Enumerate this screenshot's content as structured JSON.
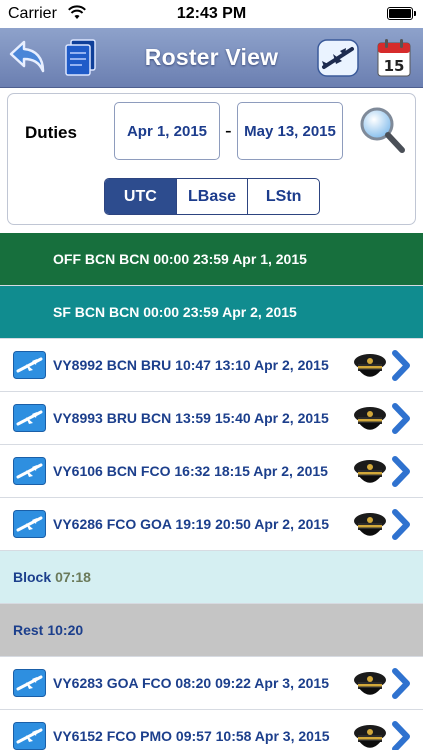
{
  "status_bar": {
    "carrier": "Carrier",
    "time": "12:43 PM"
  },
  "nav": {
    "title": "Roster View"
  },
  "filter": {
    "label": "Duties",
    "date_from": "Apr 1, 2015",
    "separator": "-",
    "date_to": "May 13, 2015",
    "time_modes": [
      "UTC",
      "LBase",
      "LStn"
    ],
    "selected_mode": "UTC"
  },
  "rows": [
    {
      "kind": "duty",
      "variant": "off",
      "text": "OFF BCN BCN 00:00 23:59 Apr 1, 2015"
    },
    {
      "kind": "duty",
      "variant": "sf",
      "text": "SF BCN BCN 00:00 23:59 Apr 2, 2015"
    },
    {
      "kind": "flight",
      "text": "VY8992 BCN BRU 10:47 13:10 Apr 2, 2015"
    },
    {
      "kind": "flight",
      "text": "VY8993 BRU BCN 13:59 15:40 Apr 2, 2015"
    },
    {
      "kind": "flight",
      "text": "VY6106 BCN FCO 16:32 18:15 Apr 2, 2015"
    },
    {
      "kind": "flight",
      "text": "VY6286 FCO GOA 19:19 20:50 Apr 2, 2015"
    },
    {
      "kind": "block",
      "label": "Block",
      "value": "07:18"
    },
    {
      "kind": "rest",
      "label": "Rest",
      "value": "10:20"
    },
    {
      "kind": "flight",
      "text": "VY6283 GOA FCO 08:20 09:22 Apr 3, 2015"
    },
    {
      "kind": "flight",
      "text": "VY6152 FCO PMO 09:57 10:58 Apr 3, 2015"
    }
  ],
  "icons": {
    "back": "back-arrow-icon",
    "notes": "notes-icon",
    "plane": "airplane-icon",
    "calendar": "calendar-icon",
    "calendar_day": "15",
    "search": "magnifier-icon",
    "flight": "airplane-icon",
    "crew": "captain-hat-icon",
    "disclosure": "chevron-right-icon"
  },
  "colors": {
    "nav": "#7b8fc0",
    "off_duty": "#176f3d",
    "sf_duty": "#108c8f",
    "block": "#d5eff2",
    "rest": "#c5c5c5",
    "accent": "#2d4c8e"
  }
}
